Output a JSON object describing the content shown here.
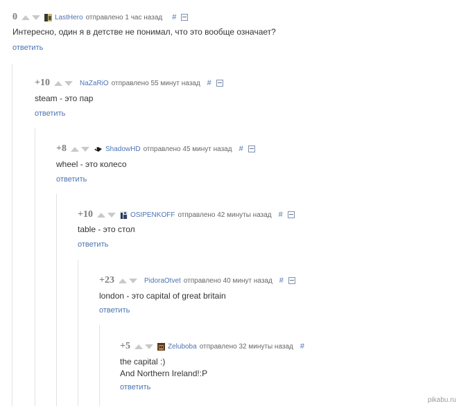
{
  "comments": [
    {
      "rating": "0",
      "user": "LastHero",
      "meta": "отправлено 1 час назад",
      "hash": "#",
      "text": [
        "Интересно, один я в детстве не понимал, что это вообще означает?"
      ],
      "reply": "ответить"
    },
    {
      "rating": "+10",
      "user": "NaZaRiO",
      "meta": "отправлено 55 минут назад",
      "hash": "#",
      "text": [
        "steam - это пар"
      ],
      "reply": "ответить"
    },
    {
      "rating": "+8",
      "user": "ShadowHD",
      "meta": "отправлено 45 минут назад",
      "hash": "#",
      "text": [
        "wheel - это колесо"
      ],
      "reply": "ответить"
    },
    {
      "rating": "+10",
      "user": "OSIPENKOFF",
      "meta": "отправлено 42 минуты назад",
      "hash": "#",
      "text": [
        "table - это стол"
      ],
      "reply": "ответить"
    },
    {
      "rating": "+23",
      "user": "PidoraOtvet",
      "meta": "отправлено 40 минут назад",
      "hash": "#",
      "text": [
        "london - это capital of great britain"
      ],
      "reply": "ответить"
    },
    {
      "rating": "+5",
      "user": "Zeluboba",
      "meta": "отправлено 32 минуты назад",
      "hash": "#",
      "text": [
        "the capital :)",
        "And Northern Ireland!:P"
      ],
      "reply": "ответить"
    }
  ],
  "watermark": "pikabu.ru",
  "colors": {
    "link": "#4b73b1",
    "meta": "#666666",
    "rating": "#7d7d7d",
    "thread_line": "#e2e2e2"
  }
}
